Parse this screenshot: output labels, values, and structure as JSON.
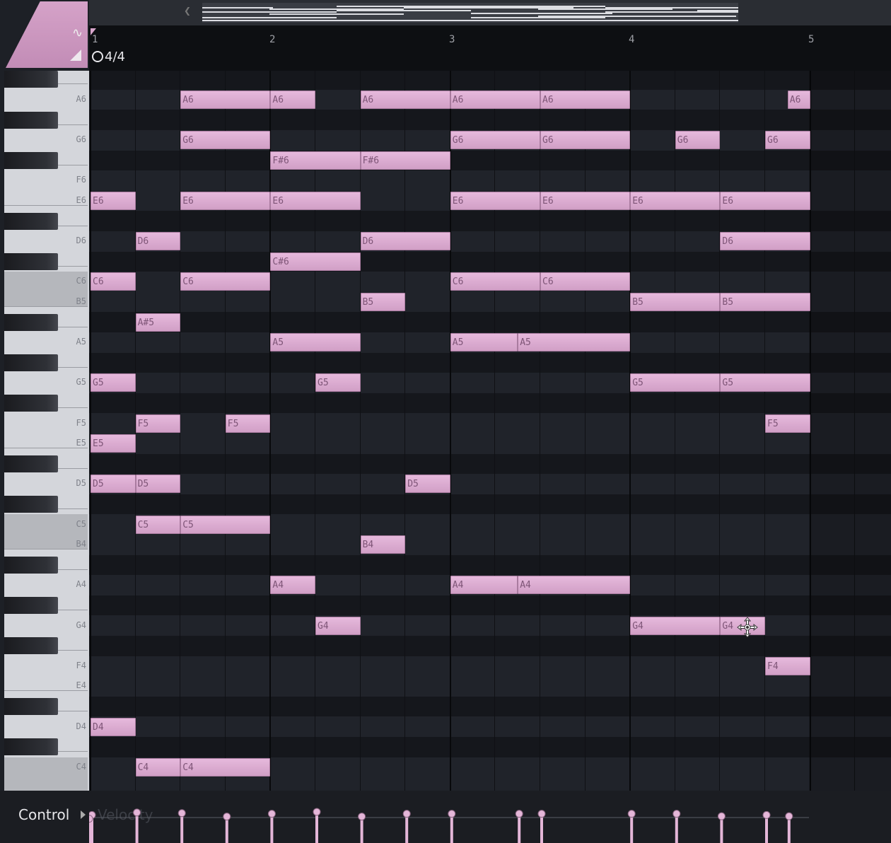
{
  "app": {
    "accent_color": "#d9a8cf"
  },
  "toolbar": {
    "snap_icon": "snap-icon",
    "stamp_icon": "stamp-icon",
    "nav_icon": "chevron-left-icon"
  },
  "ruler": {
    "bars": [
      "1",
      "2",
      "3",
      "4",
      "5"
    ],
    "time_signature": "4/4"
  },
  "keyboard": {
    "labels": [
      "A6",
      "G6",
      "F6",
      "E6",
      "D6",
      "C6",
      "B5",
      "A5",
      "G5",
      "F5",
      "E5",
      "D5",
      "C5",
      "B4",
      "A4",
      "G4",
      "F4",
      "E4",
      "D4",
      "C4"
    ]
  },
  "notes": [
    {
      "label": "A6",
      "pitch": "A6",
      "start": 2,
      "len": 2
    },
    {
      "label": "A6",
      "pitch": "A6",
      "start": 4,
      "len": 1
    },
    {
      "label": "A6",
      "pitch": "A6",
      "start": 6,
      "len": 2
    },
    {
      "label": "A6",
      "pitch": "A6",
      "start": 8,
      "len": 2
    },
    {
      "label": "A6",
      "pitch": "A6",
      "start": 10,
      "len": 2
    },
    {
      "label": "A6",
      "pitch": "A6",
      "start": 15.5,
      "len": 0.5
    },
    {
      "label": "G6",
      "pitch": "G6",
      "start": 2,
      "len": 2
    },
    {
      "label": "G6",
      "pitch": "G6",
      "start": 8,
      "len": 2
    },
    {
      "label": "G6",
      "pitch": "G6",
      "start": 10,
      "len": 2
    },
    {
      "label": "G6",
      "pitch": "G6",
      "start": 13,
      "len": 1
    },
    {
      "label": "G6",
      "pitch": "G6",
      "start": 15,
      "len": 1
    },
    {
      "label": "F#6",
      "pitch": "F#6",
      "start": 4,
      "len": 2
    },
    {
      "label": "F#6",
      "pitch": "F#6",
      "start": 6,
      "len": 2
    },
    {
      "label": "E6",
      "pitch": "E6",
      "start": 0,
      "len": 1
    },
    {
      "label": "E6",
      "pitch": "E6",
      "start": 2,
      "len": 2
    },
    {
      "label": "E6",
      "pitch": "E6",
      "start": 4,
      "len": 2
    },
    {
      "label": "E6",
      "pitch": "E6",
      "start": 8,
      "len": 2
    },
    {
      "label": "E6",
      "pitch": "E6",
      "start": 10,
      "len": 2
    },
    {
      "label": "E6",
      "pitch": "E6",
      "start": 12,
      "len": 2
    },
    {
      "label": "E6",
      "pitch": "E6",
      "start": 14,
      "len": 2
    },
    {
      "label": "D6",
      "pitch": "D6",
      "start": 1,
      "len": 1
    },
    {
      "label": "D6",
      "pitch": "D6",
      "start": 6,
      "len": 2
    },
    {
      "label": "D6",
      "pitch": "D6",
      "start": 14,
      "len": 2
    },
    {
      "label": "C#6",
      "pitch": "C#6",
      "start": 4,
      "len": 2
    },
    {
      "label": "C6",
      "pitch": "C6",
      "start": 0,
      "len": 1
    },
    {
      "label": "C6",
      "pitch": "C6",
      "start": 2,
      "len": 2
    },
    {
      "label": "C6",
      "pitch": "C6",
      "start": 8,
      "len": 2
    },
    {
      "label": "C6",
      "pitch": "C6",
      "start": 10,
      "len": 2
    },
    {
      "label": "B5",
      "pitch": "B5",
      "start": 6,
      "len": 1
    },
    {
      "label": "B5",
      "pitch": "B5",
      "start": 12,
      "len": 2
    },
    {
      "label": "B5",
      "pitch": "B5",
      "start": 14,
      "len": 2
    },
    {
      "label": "A#5",
      "pitch": "A#5",
      "start": 1,
      "len": 1
    },
    {
      "label": "A5",
      "pitch": "A5",
      "start": 4,
      "len": 2
    },
    {
      "label": "A5",
      "pitch": "A5",
      "start": 8,
      "len": 1.5
    },
    {
      "label": "A5",
      "pitch": "A5",
      "start": 9.5,
      "len": 2.5
    },
    {
      "label": "G5",
      "pitch": "G5",
      "start": 0,
      "len": 1
    },
    {
      "label": "G5",
      "pitch": "G5",
      "start": 5,
      "len": 1
    },
    {
      "label": "G5",
      "pitch": "G5",
      "start": 12,
      "len": 2
    },
    {
      "label": "G5",
      "pitch": "G5",
      "start": 14,
      "len": 2
    },
    {
      "label": "F5",
      "pitch": "F5",
      "start": 1,
      "len": 1
    },
    {
      "label": "F5",
      "pitch": "F5",
      "start": 3,
      "len": 1
    },
    {
      "label": "F5",
      "pitch": "F5",
      "start": 15,
      "len": 1
    },
    {
      "label": "E5",
      "pitch": "E5",
      "start": 0,
      "len": 1
    },
    {
      "label": "D5",
      "pitch": "D5",
      "start": 0,
      "len": 1
    },
    {
      "label": "D5",
      "pitch": "D5",
      "start": 1,
      "len": 1
    },
    {
      "label": "D5",
      "pitch": "D5",
      "start": 7,
      "len": 1
    },
    {
      "label": "C5",
      "pitch": "C5",
      "start": 1,
      "len": 1
    },
    {
      "label": "C5",
      "pitch": "C5",
      "start": 2,
      "len": 2
    },
    {
      "label": "B4",
      "pitch": "B4",
      "start": 6,
      "len": 1
    },
    {
      "label": "A4",
      "pitch": "A4",
      "start": 4,
      "len": 1
    },
    {
      "label": "A4",
      "pitch": "A4",
      "start": 8,
      "len": 1.5
    },
    {
      "label": "A4",
      "pitch": "A4",
      "start": 9.5,
      "len": 2.5
    },
    {
      "label": "G4",
      "pitch": "G4",
      "start": 5,
      "len": 1
    },
    {
      "label": "G4",
      "pitch": "G4",
      "start": 12,
      "len": 2
    },
    {
      "label": "G4",
      "pitch": "G4",
      "start": 14,
      "len": 1
    },
    {
      "label": "F4",
      "pitch": "F4",
      "start": 15,
      "len": 1
    },
    {
      "label": "D4",
      "pitch": "D4",
      "start": 0,
      "len": 1
    },
    {
      "label": "C4",
      "pitch": "C4",
      "start": 1,
      "len": 1
    },
    {
      "label": "C4",
      "pitch": "C4",
      "start": 2,
      "len": 2
    }
  ],
  "cursor": {
    "icon": "move-cursor-icon"
  },
  "control": {
    "label": "Control",
    "parameter": "Velocity",
    "velocities": [
      0.9,
      0.98,
      0.96,
      0.85,
      0.94,
      1.0,
      0.85,
      0.94,
      0.94,
      0.94,
      0.94,
      0.94,
      0.94,
      0.86,
      0.9,
      0.86,
      0.78
    ]
  }
}
